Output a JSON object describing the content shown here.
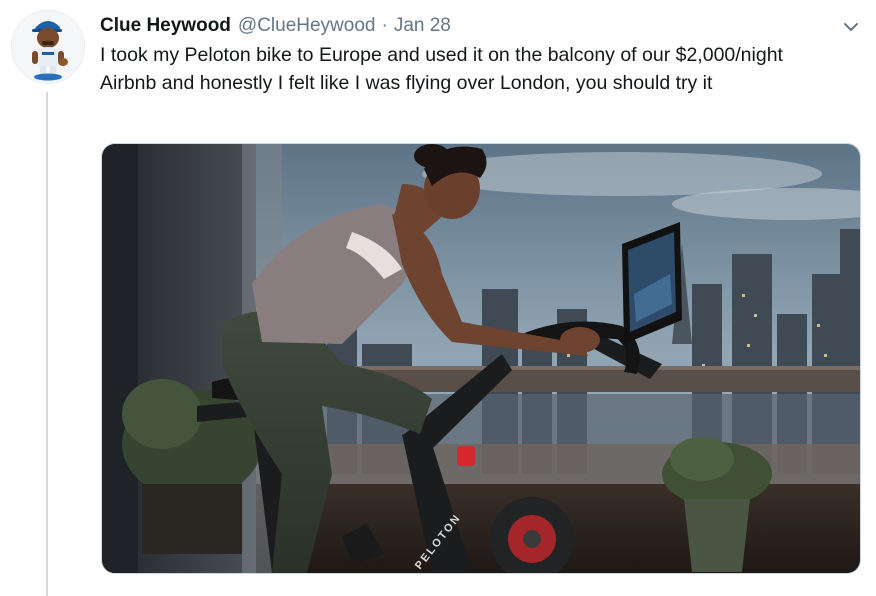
{
  "tweet": {
    "display_name": "Clue Heywood",
    "handle": "@ClueHeywood",
    "separator": "·",
    "date": "Jan 28",
    "text": "I took my Peloton bike to Europe and used it on the balcony of our $2,000/night Airbnb and honestly I felt like I was flying over London, you should try it"
  },
  "media": {
    "brand_lettering": "PELOTON",
    "subject": "woman riding a Peloton bike on a balcony overlooking London at dusk"
  },
  "icons": {
    "menu": "chevron-down-icon",
    "avatar": "bobblehead-avatar"
  },
  "colors": {
    "text": "#14171a",
    "secondary_text": "#657786",
    "thread_line": "#cfd9de",
    "media_border": "#ccd6dd"
  }
}
